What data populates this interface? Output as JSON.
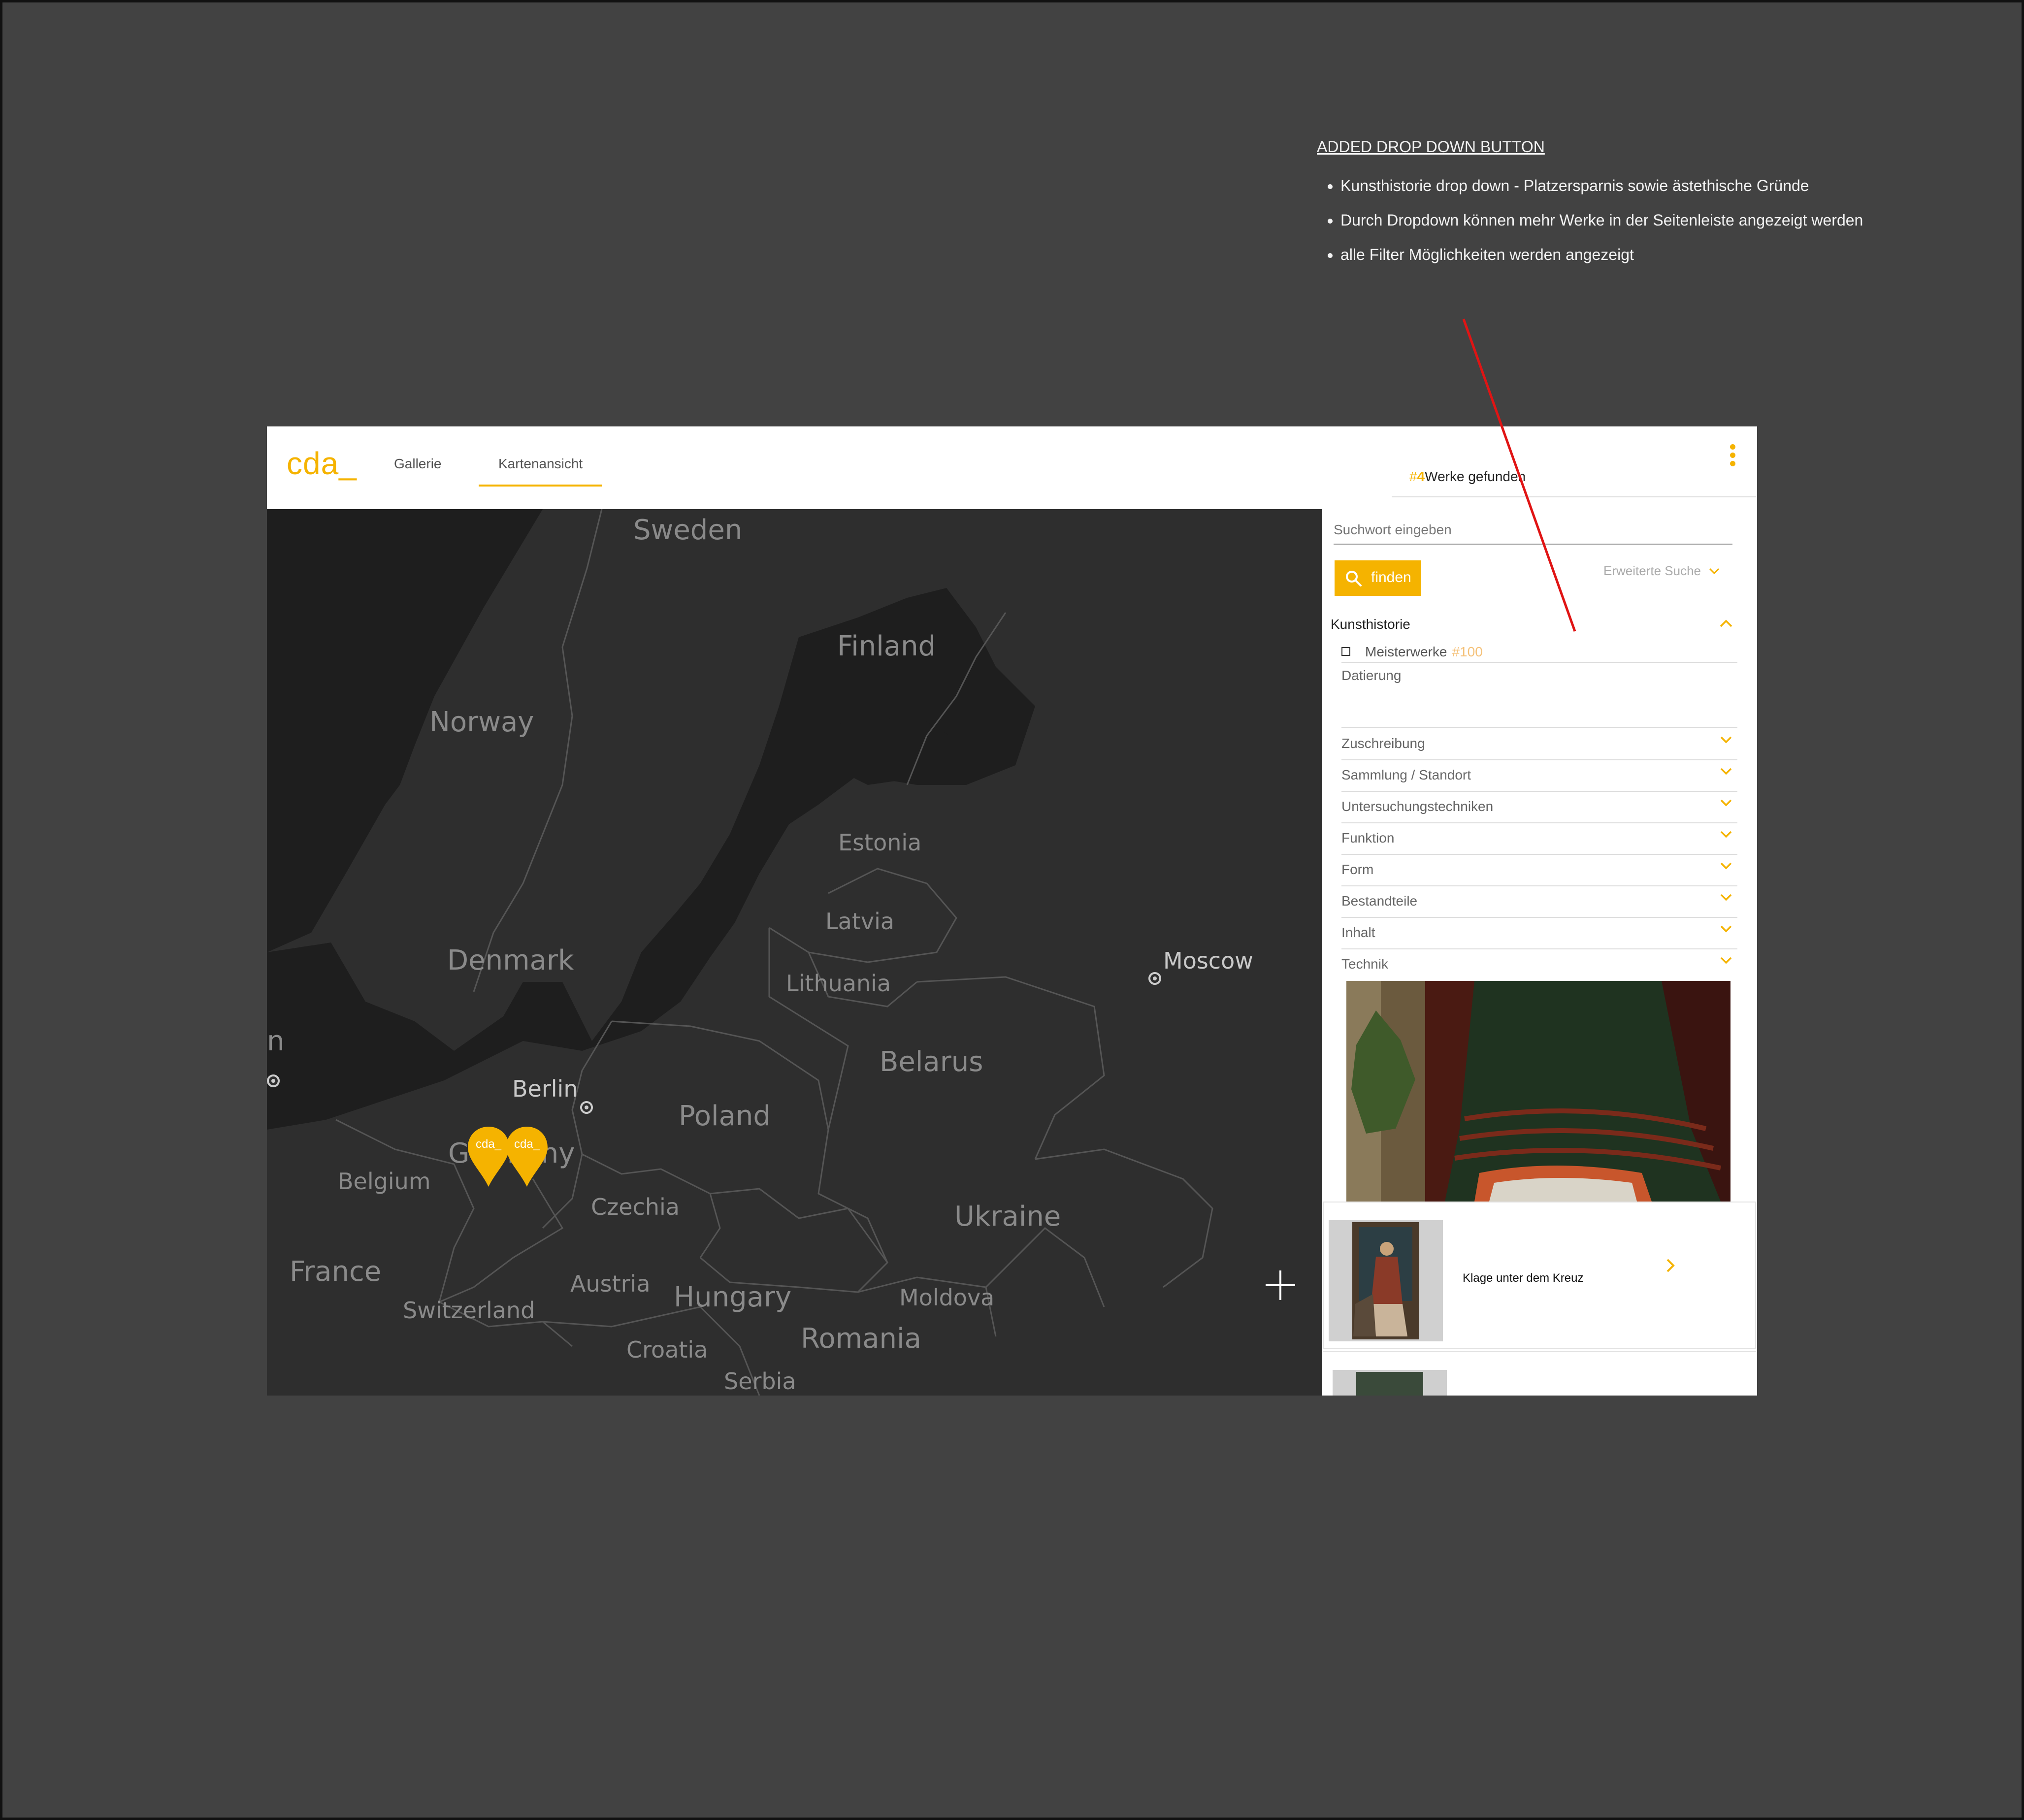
{
  "annotation": {
    "title": "ADDED DROP DOWN BUTTON",
    "bullets": [
      "Kunsthistorie drop down - Platzersparnis sowie ästethische Gründe",
      "Durch Dropdown können mehr Werke in der Seitenleiste angezeigt werden",
      "alle Filter Möglichkeiten werden angezeigt"
    ],
    "arrow_color": "#e01414"
  },
  "header": {
    "logo": "cda_",
    "tabs": [
      {
        "label": "Gallerie",
        "active": false
      },
      {
        "label": "Kartenansicht",
        "active": true
      }
    ],
    "results_hash": "#",
    "results_count": "4",
    "results_text": "Werke gefunden",
    "menu_icon": "kebab-menu-icon"
  },
  "map": {
    "labels": {
      "sweden": "Sweden",
      "finland": "Finland",
      "norway": "Norway",
      "estonia": "Estonia",
      "latvia": "Latvia",
      "lithuania": "Lithuania",
      "denmark": "Denmark",
      "moscow": "Moscow",
      "belarus": "Belarus",
      "berlin": "Berlin",
      "poland": "Poland",
      "germany": "Germany",
      "belgium": "Belgium",
      "czechia": "Czechia",
      "ukraine": "Ukraine",
      "france": "France",
      "austria": "Austria",
      "hungary": "Hungary",
      "moldova": "Moldova",
      "switzerland": "Switzerland",
      "croatia": "Croatia",
      "romania": "Romania",
      "serbia": "Serbia",
      "edge_n": "n"
    },
    "pins": [
      {
        "label": "cda_"
      },
      {
        "label": "cda_"
      }
    ],
    "zoom_icon": "plus-icon"
  },
  "sidebar": {
    "search_placeholder": "Suchwort eingeben",
    "find_label": "finden",
    "extended_search": "Erweiterte Suche",
    "section_title": "Kunsthistorie",
    "meisterwerke_label": "Meisterwerke",
    "meisterwerke_count": "#100",
    "datierung_label": "Datierung",
    "filters": [
      "Zuschreibung",
      "Sammlung / Standort",
      "Untersuchungstechniken",
      "Funktion",
      "Form",
      "Bestandteile",
      "Inhalt",
      "Technik"
    ],
    "result_card": {
      "title": "Klage unter dem Kreuz"
    }
  },
  "colors": {
    "accent": "#f5b300",
    "background": "#424242",
    "map_water": "#1e1e1e",
    "map_land": "#2e2e2e"
  }
}
